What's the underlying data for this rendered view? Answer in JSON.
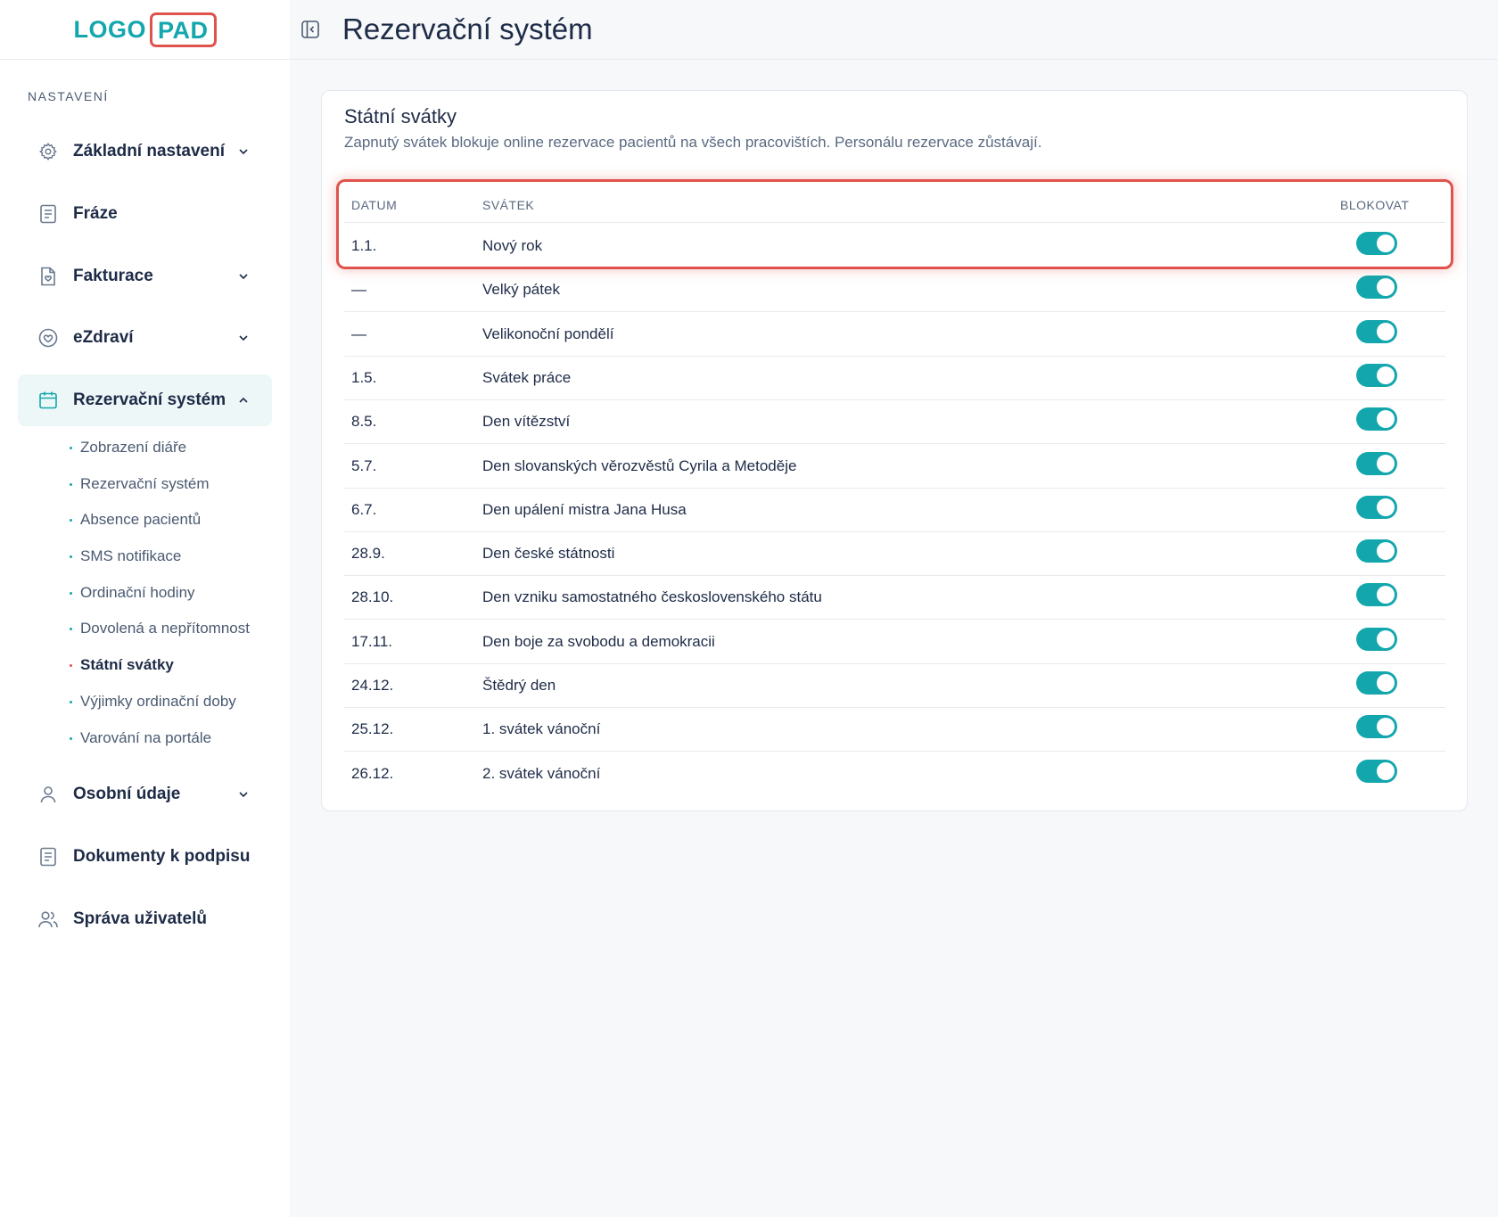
{
  "logo": {
    "part1": "LOGO",
    "part2": "PAD"
  },
  "sidebar": {
    "section_label": "NASTAVENÍ",
    "items": [
      {
        "label": "Základní nastavení",
        "icon": "gear-icon",
        "has_chevron": true
      },
      {
        "label": "Fráze",
        "icon": "document-icon",
        "has_chevron": false
      },
      {
        "label": "Fakturace",
        "icon": "invoice-icon",
        "has_chevron": true
      },
      {
        "label": "eZdraví",
        "icon": "heart-icon",
        "has_chevron": true
      },
      {
        "label": "Rezervační systém",
        "icon": "calendar-icon",
        "has_chevron": true,
        "active": true
      },
      {
        "label": "Osobní údaje",
        "icon": "user-icon",
        "has_chevron": true
      },
      {
        "label": "Dokumenty k podpisu",
        "icon": "document-icon",
        "has_chevron": false
      },
      {
        "label": "Správa uživatelů",
        "icon": "users-icon",
        "has_chevron": false
      }
    ],
    "subitems": [
      {
        "label": "Zobrazení diáře"
      },
      {
        "label": "Rezervační systém"
      },
      {
        "label": "Absence pacientů"
      },
      {
        "label": "SMS notifikace"
      },
      {
        "label": "Ordinační hodiny"
      },
      {
        "label": "Dovolená a nepřítomnost"
      },
      {
        "label": "Státní svátky",
        "active": true
      },
      {
        "label": "Výjimky ordinační doby"
      },
      {
        "label": "Varování na portále"
      }
    ]
  },
  "header": {
    "title": "Rezervační systém"
  },
  "card": {
    "title": "Státní svátky",
    "description": "Zapnutý svátek blokuje online rezervace pacientů na všech pracovištích. Personálu rezervace zůstávají.",
    "columns": {
      "date": "DATUM",
      "holiday": "SVÁTEK",
      "block": "BLOKOVAT"
    },
    "rows": [
      {
        "date": "1.1.",
        "name": "Nový rok",
        "blocked": true
      },
      {
        "date": "—",
        "name": "Velký pátek",
        "blocked": true
      },
      {
        "date": "—",
        "name": "Velikonoční pondělí",
        "blocked": true
      },
      {
        "date": "1.5.",
        "name": "Svátek práce",
        "blocked": true
      },
      {
        "date": "8.5.",
        "name": "Den vítězství",
        "blocked": true
      },
      {
        "date": "5.7.",
        "name": "Den slovanských věrozvěstů Cyrila a Metoděje",
        "blocked": true
      },
      {
        "date": "6.7.",
        "name": "Den upálení mistra Jana Husa",
        "blocked": true
      },
      {
        "date": "28.9.",
        "name": "Den české státnosti",
        "blocked": true
      },
      {
        "date": "28.10.",
        "name": "Den vzniku samostatného československého státu",
        "blocked": true
      },
      {
        "date": "17.11.",
        "name": "Den boje za svobodu a demokracii",
        "blocked": true
      },
      {
        "date": "24.12.",
        "name": "Štědrý den",
        "blocked": true
      },
      {
        "date": "25.12.",
        "name": "1. svátek vánoční",
        "blocked": true
      },
      {
        "date": "26.12.",
        "name": "2. svátek vánoční",
        "blocked": true
      }
    ]
  },
  "colors": {
    "accent": "#13a7ad",
    "highlight": "#e0524c",
    "text": "#1e2b47"
  }
}
